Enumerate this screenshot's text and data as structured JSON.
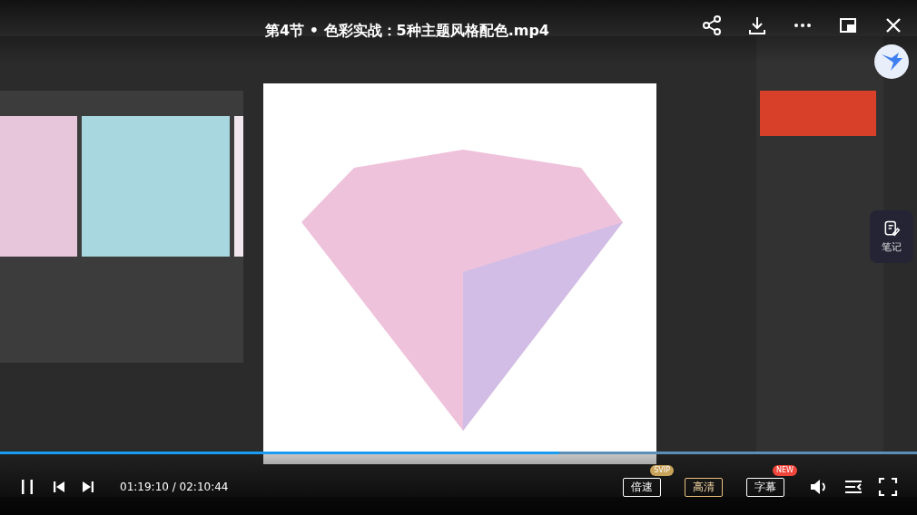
{
  "title": "第4节 • 色彩实战：5种主题风格配色.mp4",
  "note_button": {
    "label": "笔记"
  },
  "player": {
    "playing": true,
    "progress": {
      "level": 0.61
    },
    "time": "01:19:10 / 02:10:44",
    "options": [
      {
        "label": "倍速",
        "selected": false,
        "badge": {
          "text": "SVIP",
          "color": "#c9a25a"
        }
      },
      {
        "label": "高清",
        "selected": true
      },
      {
        "label": "字幕",
        "selected": false,
        "badge": {
          "text": "NEW",
          "color": "#f0453a"
        }
      }
    ]
  }
}
